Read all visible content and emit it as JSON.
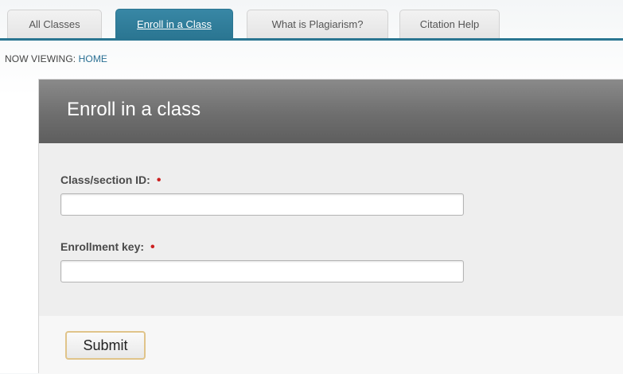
{
  "tabs": {
    "all_classes": "All Classes",
    "enroll": "Enroll in a Class",
    "plagiarism": "What is Plagiarism?",
    "citation": "Citation Help"
  },
  "breadcrumb": {
    "prefix": "NOW VIEWING:",
    "current": "HOME"
  },
  "form": {
    "title": "Enroll in a class",
    "class_label": "Class/section ID:",
    "class_value": "",
    "key_label": "Enrollment key:",
    "key_value": "",
    "required_marker": "•",
    "submit_label": "Submit"
  },
  "colors": {
    "accent": "#2a7591",
    "required": "#cc1f1f",
    "header": "#6e6e6e"
  }
}
